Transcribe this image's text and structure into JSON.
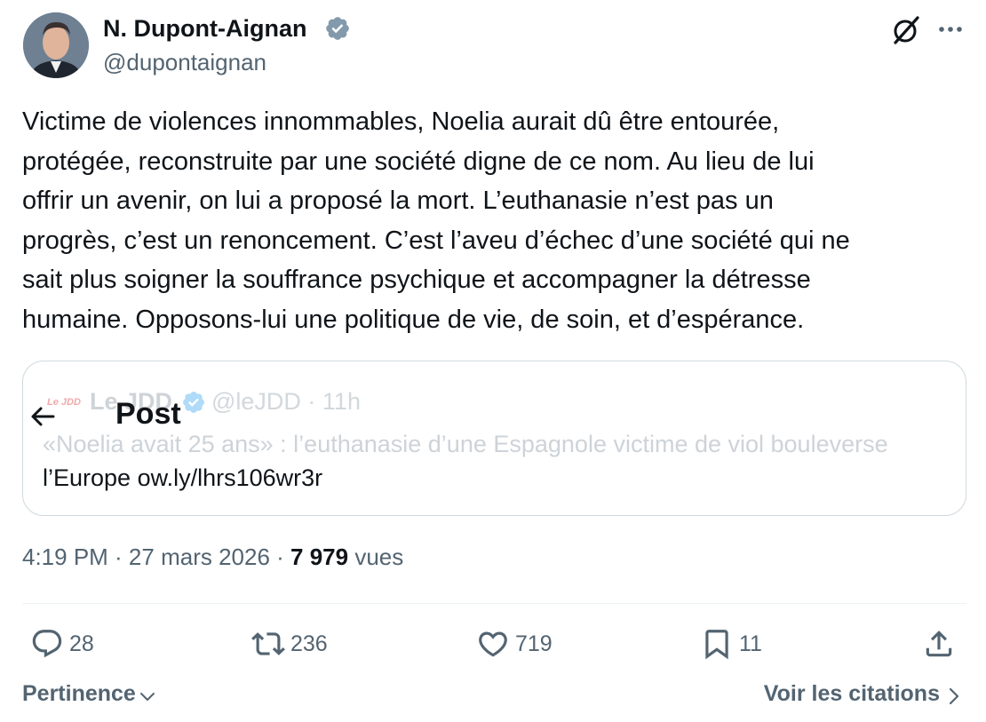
{
  "author": {
    "name": "N. Dupont-Aignan",
    "handle": "@dupontaignan",
    "verified_color": "#829aab"
  },
  "tweet": {
    "text": "Victime de violences innommables, Noelia aurait dû être entourée,\nprotégée, reconstruite par une société digne de ce nom. Au lieu de lui\noffrir un avenir, on lui a proposé la mort. L’euthanasie n’est pas un\nprogrès, c’est un renoncement. C’est l’aveu d’échec d’une société qui ne\nsait plus soigner la souffrance psychique et accompagner la détresse\nhumaine. Opposons-lui une politique de vie, de soin, et d’espérance."
  },
  "quote": {
    "logo_text": "Le JDD",
    "name": "Le JDD",
    "handle_time": "@leJDD · 11h",
    "overlay_title": "Post",
    "text_line1": "«Noelia avait 25 ans» : l’euthanasie d’une Espagnole victime de viol bouleverse",
    "text_line2": "l’Europe ow.ly/lhrs106wr3r"
  },
  "meta": {
    "time_date": "4:19 PM · 27 mars 2026 · ",
    "views_count": "7 979",
    "views_label": " vues"
  },
  "actions": {
    "replies": "28",
    "reposts": "236",
    "likes": "719",
    "bookmarks": "11"
  },
  "footer": {
    "sort_label": "Pertinence",
    "quotes_label": "Voir les citations"
  },
  "colors": {
    "text": "#0f1419",
    "secondary": "#536471",
    "border": "#cfd9de"
  }
}
